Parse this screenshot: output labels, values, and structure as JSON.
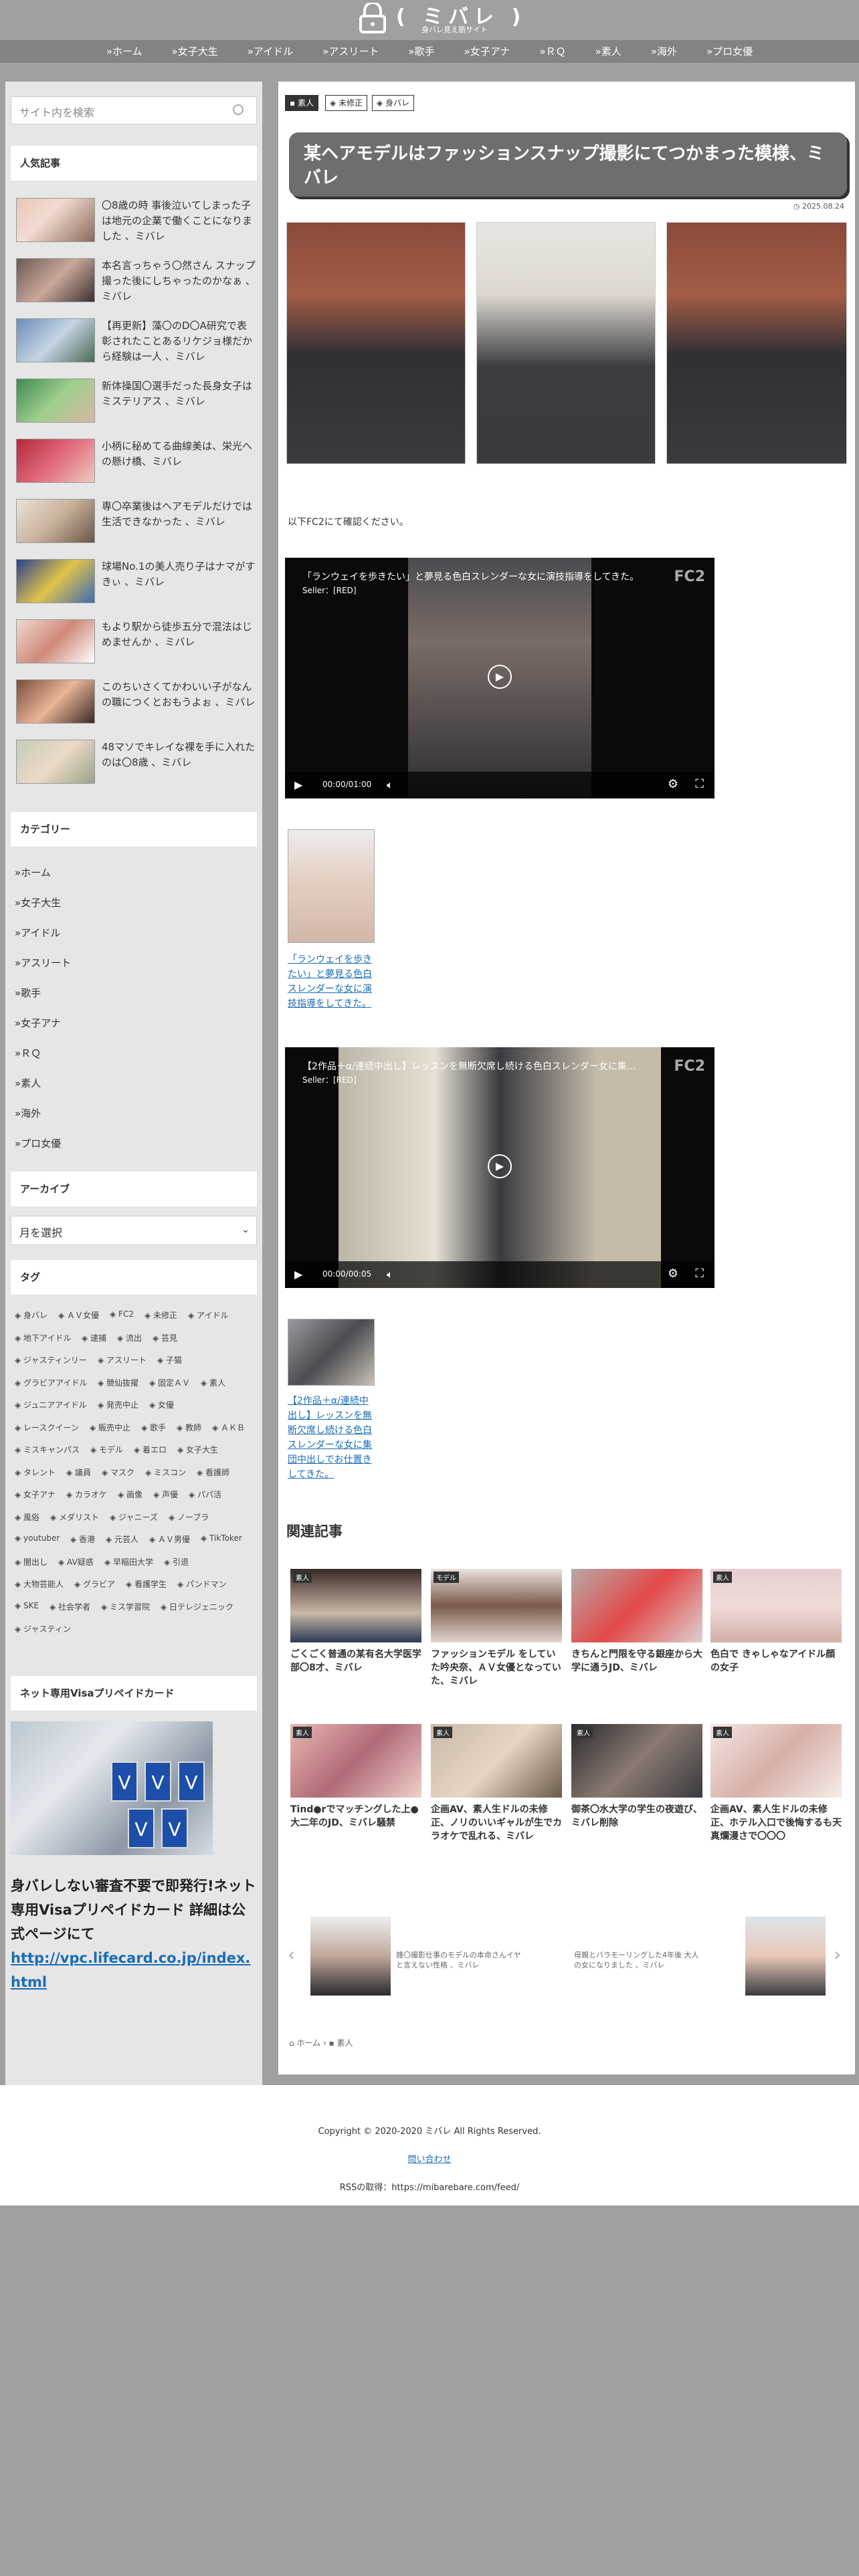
{
  "site": {
    "logo_text": "( ミバレ )",
    "logo_sub": "身バレ見え筋サイト"
  },
  "nav": [
    "»ホーム",
    "»女子大生",
    "»アイドル",
    "»アスリート",
    "»歌手",
    "»女子アナ",
    "»ＲＱ",
    "»素人",
    "»海外",
    "»プロ女優"
  ],
  "sidebar": {
    "search_placeholder": "サイト内を検索",
    "popular_title": "人気記事",
    "popular": [
      "〇8歳の時 事後泣いてしまった子は地元の企業で働くことになりました 、ミバレ",
      "本名言っちゃう〇然さん スナップ撮った後にしちゃったのかなぁ 、ミバレ",
      "【再更新】藻〇のD〇A研究で表彰されたことあるリケジョ様だから経験は一人 、ミバレ",
      "新体操国〇選手だった長身女子はミステリアス 、ミバレ",
      "小柄に秘めてる曲線美は、栄光への懸け橋、ミバレ",
      "専〇卒業後はヘアモデルだけでは生活できなかった 、ミバレ",
      "球場No.1の美人売り子はナマがすきぃ 、ミバレ",
      "もより駅から徒歩五分で混法はじめませんか 、ミバレ",
      "このちいさくてかわいい子がなんの職につくとおもうよぉ 、ミバレ",
      "48マソでキレイな裸を手に入れたのは〇8歳 、ミバレ"
    ],
    "category_title": "カテゴリー",
    "categories": [
      "»ホーム",
      "»女子大生",
      "»アイドル",
      "»アスリート",
      "»歌手",
      "»女子アナ",
      "»ＲＱ",
      "»素人",
      "»海外",
      "»プロ女優"
    ],
    "archive_title": "アーカイブ",
    "archive_select": "月を選択",
    "tag_title": "タグ",
    "tags": [
      "身バレ",
      "ＡＶ女優",
      "FC2",
      "未修正",
      "アイドル",
      "地下アイドル",
      "逮捕",
      "流出",
      "芸見",
      "ジャスティンリー",
      "アスリート",
      "子猫",
      "グラビアアイドル",
      "競仙抜擢",
      "固定ＡＶ",
      "素人",
      "ジュニアアイドル",
      "発売中止",
      "女優",
      "レースクイーン",
      "販売中止",
      "歌手",
      "教師",
      "ＡＫＢ",
      "ミスキャンパス",
      "モデル",
      "着エロ",
      "女子大生",
      "タレント",
      "議員",
      "マスク",
      "ミスコン",
      "看護師",
      "女子アナ",
      "カラオケ",
      "画像",
      "声優",
      "パパ活",
      "風俗",
      "メダリスト",
      "ジャニーズ",
      "ノーブラ",
      "youtuber",
      "香港",
      "元芸人",
      "ＡＶ男優",
      "TikToker",
      "闇出し",
      "AV疑惑",
      "早稲田大学",
      "引退",
      "大物芸能人",
      "グラビア",
      "看護学生",
      "パンドマン",
      "SKE",
      "社会学者",
      "ミス学習院",
      "日テレジェニック",
      "ジャスティン"
    ],
    "card_title": "ネット専用Visaプリペイドカード",
    "card_text": "身バレしない審査不要で即発行!ネット専用Visaプリペイドカード 詳細は公式ページにて",
    "card_link": "http://vpc.lifecard.co.jp/index.html"
  },
  "article": {
    "badges": [
      "素人",
      "未修正",
      "身バレ"
    ],
    "title": "某ヘアモデルはファッションスナップ撮影にてつかまった模様、ミバレ",
    "date": "◷ 2025.08.24",
    "intro": "以下FC2にて確認ください。",
    "videos": [
      {
        "title": "「ランウェイを歩きたい」と夢見る色白スレンダーな女に演技指導をしてきた。",
        "seller": "Seller：[RED]",
        "time": "00:00/01:00"
      },
      {
        "title": "【2作品＋α/連続中出し】レッスンを無断欠席し続ける色白スレンダー女に集...",
        "seller": "Seller：[RED]",
        "time": "00:00/00:05"
      }
    ],
    "video_links": [
      "「ランウェイを歩きたい」と夢見る色白スレンダーな女に演技指導をしてきた。",
      "【2作品＋α/連続中出し】レッスンを無断欠席し続ける色白スレンダーな女に集団中出しでお仕置きしてきた。"
    ],
    "fc2_label": "FC2",
    "related_title": "関連記事",
    "related": [
      {
        "cat": "素人",
        "text": "ごくごく普通の某有名大学医学部〇8才、ミバレ"
      },
      {
        "cat": "モデル",
        "text": "ファッションモデル をしていた吟央奈、ＡＶ女優となっていた、ミバレ"
      },
      {
        "cat": "",
        "text": "きちんと門限を守る銀座から大学に通うJD、ミバレ"
      },
      {
        "cat": "素人",
        "text": "色白で きゃしゃなアイドル顔の女子"
      },
      {
        "cat": "素人",
        "text": "Tind●rでマッチングした上●大二年のJD、ミバレ騒禁"
      },
      {
        "cat": "素人",
        "text": "企画AV、素人生ドルの未修正、ノリのいいギャルが生でカラオケで乱れる、ミバレ"
      },
      {
        "cat": "素人",
        "text": "御茶〇水大学の学生の夜遊び、ミバレ削除"
      },
      {
        "cat": "素人",
        "text": "企画AV、素人生ドルの未修正、ホテル入口で後悔するも天真爛漫さで〇〇〇"
      }
    ],
    "carousel": [
      "雑〇撮影仕事のモデルの本命さんイヤと言えない性格 、ミバレ",
      "母親とバラモーリングした4年後 大人の女になりました 、ミバレ"
    ],
    "breadcrumb": [
      "ホーム",
      "素人"
    ]
  },
  "footer": {
    "copyright": "Copyright © 2020-2020 ミバレ All Rights Reserved.",
    "contact": "問い合わせ",
    "rss": "RSSの取得：https://mibarebare.com/feed/"
  },
  "icons": [
    "lock-icon",
    "search-icon",
    "clock-icon",
    "home-icon",
    "play-icon",
    "volume-icon",
    "gear-icon",
    "fullscreen-icon",
    "chevron-left-icon",
    "chevron-right-icon",
    "tag-icon"
  ]
}
